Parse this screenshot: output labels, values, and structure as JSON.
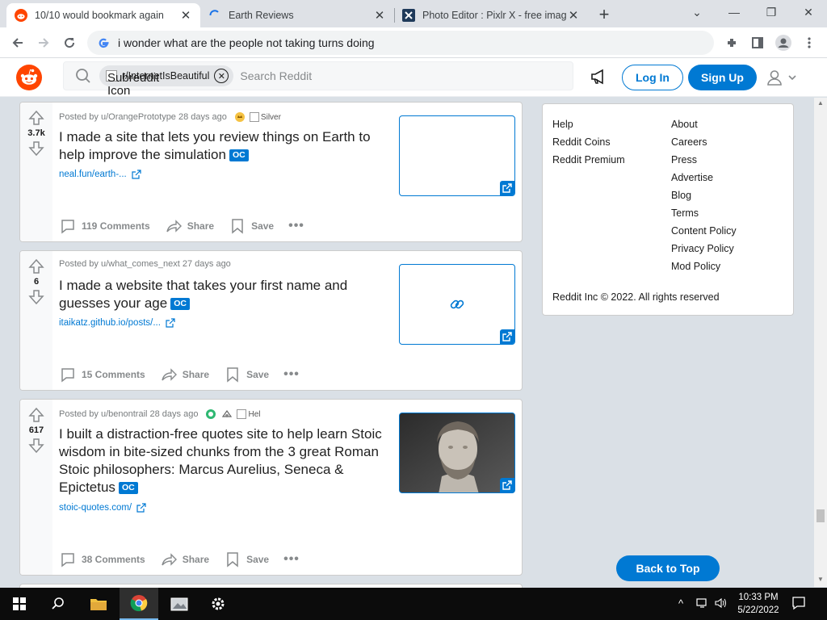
{
  "browser": {
    "tabs": [
      {
        "title": "10/10 would bookmark again",
        "active": true
      },
      {
        "title": "Earth Reviews",
        "active": false,
        "loading": true
      },
      {
        "title": "Photo Editor : Pixlr X - free image editing online",
        "active": false
      }
    ],
    "address": "i wonder what are the people not taking turns doing",
    "new_tab_label": "+"
  },
  "reddit": {
    "subreddit_chip": "r/InternetIsBeautiful",
    "subreddit_icon_alt": "Subreddit Icon",
    "search_placeholder": "Search Reddit",
    "login_label": "Log In",
    "signup_label": "Sign Up"
  },
  "posts": [
    {
      "votes": "3.7k",
      "posted_by": "Posted by u/OrangePrototype 28 days ago",
      "award_alt": "Silver",
      "title": "I made a site that lets you review things on Earth to help improve the simulation",
      "flair": "OC",
      "link": "neal.fun/earth-...",
      "comments": "119 Comments",
      "share": "Share",
      "save": "Save"
    },
    {
      "votes": "6",
      "posted_by": "Posted by u/what_comes_next 27 days ago",
      "title": "I made a website that takes your first name and guesses your age",
      "flair": "OC",
      "link": "itaikatz.github.io/posts/...",
      "comments": "15 Comments",
      "share": "Share",
      "save": "Save"
    },
    {
      "votes": "617",
      "posted_by": "Posted by u/benontrail 28 days ago",
      "award_alt": "Hel",
      "title": "I built a distraction-free quotes site to help learn Stoic wisdom in bite-sized chunks from the 3 great Roman Stoic philosophers: Marcus Aurelius, Seneca & Epictetus",
      "flair": "OC",
      "link": "stoic-quotes.com/",
      "comments": "38 Comments",
      "share": "Share",
      "save": "Save"
    }
  ],
  "sidebar": {
    "left_links": [
      "Help",
      "Reddit Coins",
      "Reddit Premium"
    ],
    "right_links": [
      "About",
      "Careers",
      "Press",
      "Advertise",
      "Blog",
      "Terms",
      "Content Policy",
      "Privacy Policy",
      "Mod Policy"
    ],
    "copyright": "Reddit Inc © 2022. All rights reserved"
  },
  "back_to_top": "Back to Top",
  "taskbar": {
    "time": "10:33 PM",
    "date": "5/22/2022"
  },
  "colors": {
    "reddit_blue": "#0079d3",
    "reddit_orange": "#ff4500",
    "background": "#dae0e6"
  }
}
